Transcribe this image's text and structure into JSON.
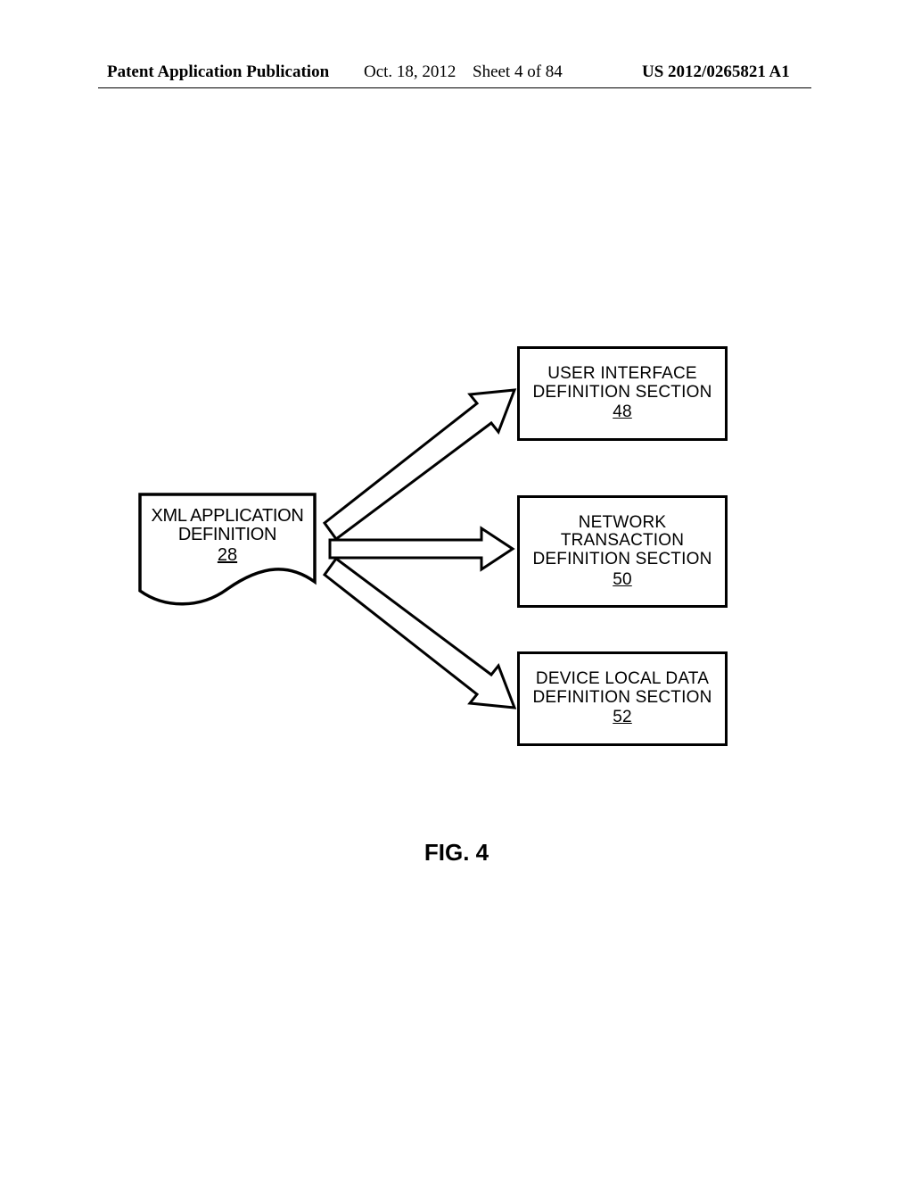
{
  "header": {
    "publication": "Patent Application Publication",
    "date": "Oct. 18, 2012",
    "sheet": "Sheet 4 of 84",
    "doc_number": "US 2012/0265821 A1"
  },
  "source_doc": {
    "line1": "XML APPLICATION",
    "line2": "DEFINITION",
    "ref": "28"
  },
  "box_ui": {
    "line1": "USER INTERFACE",
    "line2": "DEFINITION SECTION",
    "ref": "48"
  },
  "box_net": {
    "line1": "NETWORK",
    "line2": "TRANSACTION",
    "line3": "DEFINITION SECTION",
    "ref": "50"
  },
  "box_dev": {
    "line1": "DEVICE LOCAL DATA",
    "line2": "DEFINITION SECTION",
    "ref": "52"
  },
  "figure_caption": "FIG. 4"
}
